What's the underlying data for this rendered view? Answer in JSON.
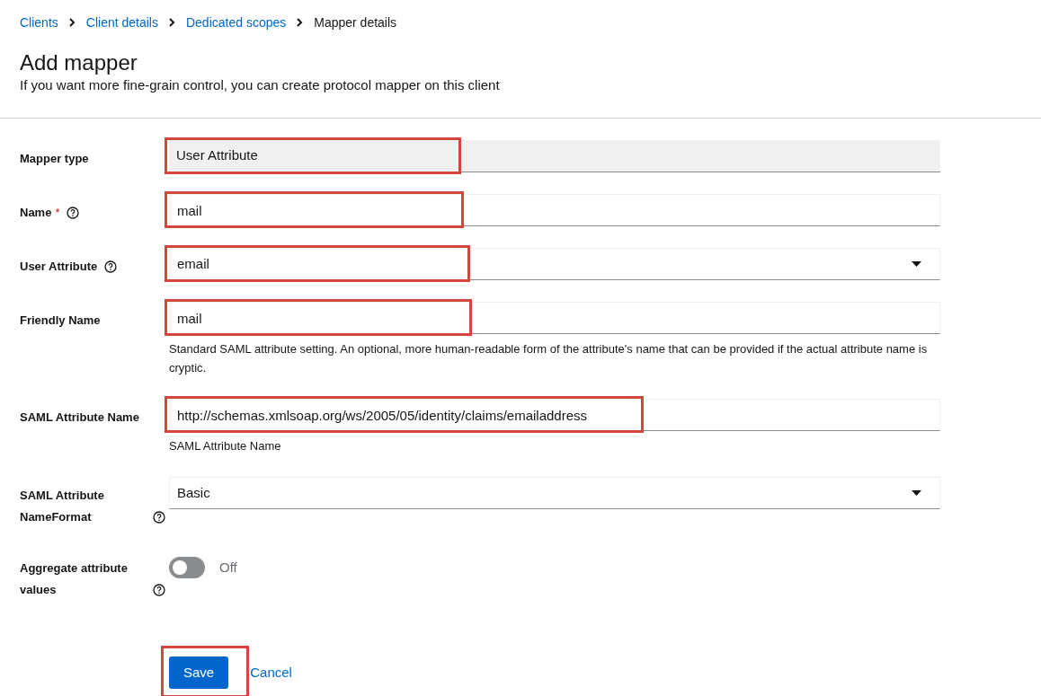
{
  "breadcrumb": [
    {
      "label": "Clients",
      "link": true
    },
    {
      "label": "Client details",
      "link": true
    },
    {
      "label": "Dedicated scopes",
      "link": true
    },
    {
      "label": "Mapper details",
      "link": false
    }
  ],
  "header": {
    "title": "Add mapper",
    "subtitle": "If you want more fine-grain control, you can create protocol mapper on this client"
  },
  "fields": [
    {
      "kind": "readonly",
      "label": "Mapper type",
      "value": "User Attribute",
      "help": false,
      "highlighted": true
    },
    {
      "kind": "text",
      "label": "Name",
      "value": "mail",
      "required_mark": "*",
      "help": true,
      "highlighted": true
    },
    {
      "kind": "select",
      "label": "User Attribute",
      "value": "email",
      "help": true,
      "highlighted": true
    },
    {
      "kind": "text",
      "label": "Friendly Name",
      "value": "mail",
      "help": false,
      "highlighted": true,
      "helper": "Standard SAML attribute setting. An optional, more human-readable form of the attribute's name that can be provided if the actual attribute name is cryptic."
    },
    {
      "kind": "text",
      "label": "SAML Attribute Name",
      "value": "http://schemas.xmlsoap.org/ws/2005/05/identity/claims/emailaddress",
      "help": false,
      "highlighted": true,
      "helper": "SAML Attribute Name"
    },
    {
      "kind": "select",
      "label": "SAML Attribute NameFormat",
      "value": "Basic",
      "help": true,
      "highlighted": false
    },
    {
      "kind": "toggle",
      "label": "Aggregate attribute values",
      "value": "Off",
      "on": false,
      "help": true,
      "highlighted": false
    }
  ],
  "actions": {
    "save": {
      "label": "Save",
      "highlighted": true
    },
    "cancel": {
      "label": "Cancel"
    }
  }
}
